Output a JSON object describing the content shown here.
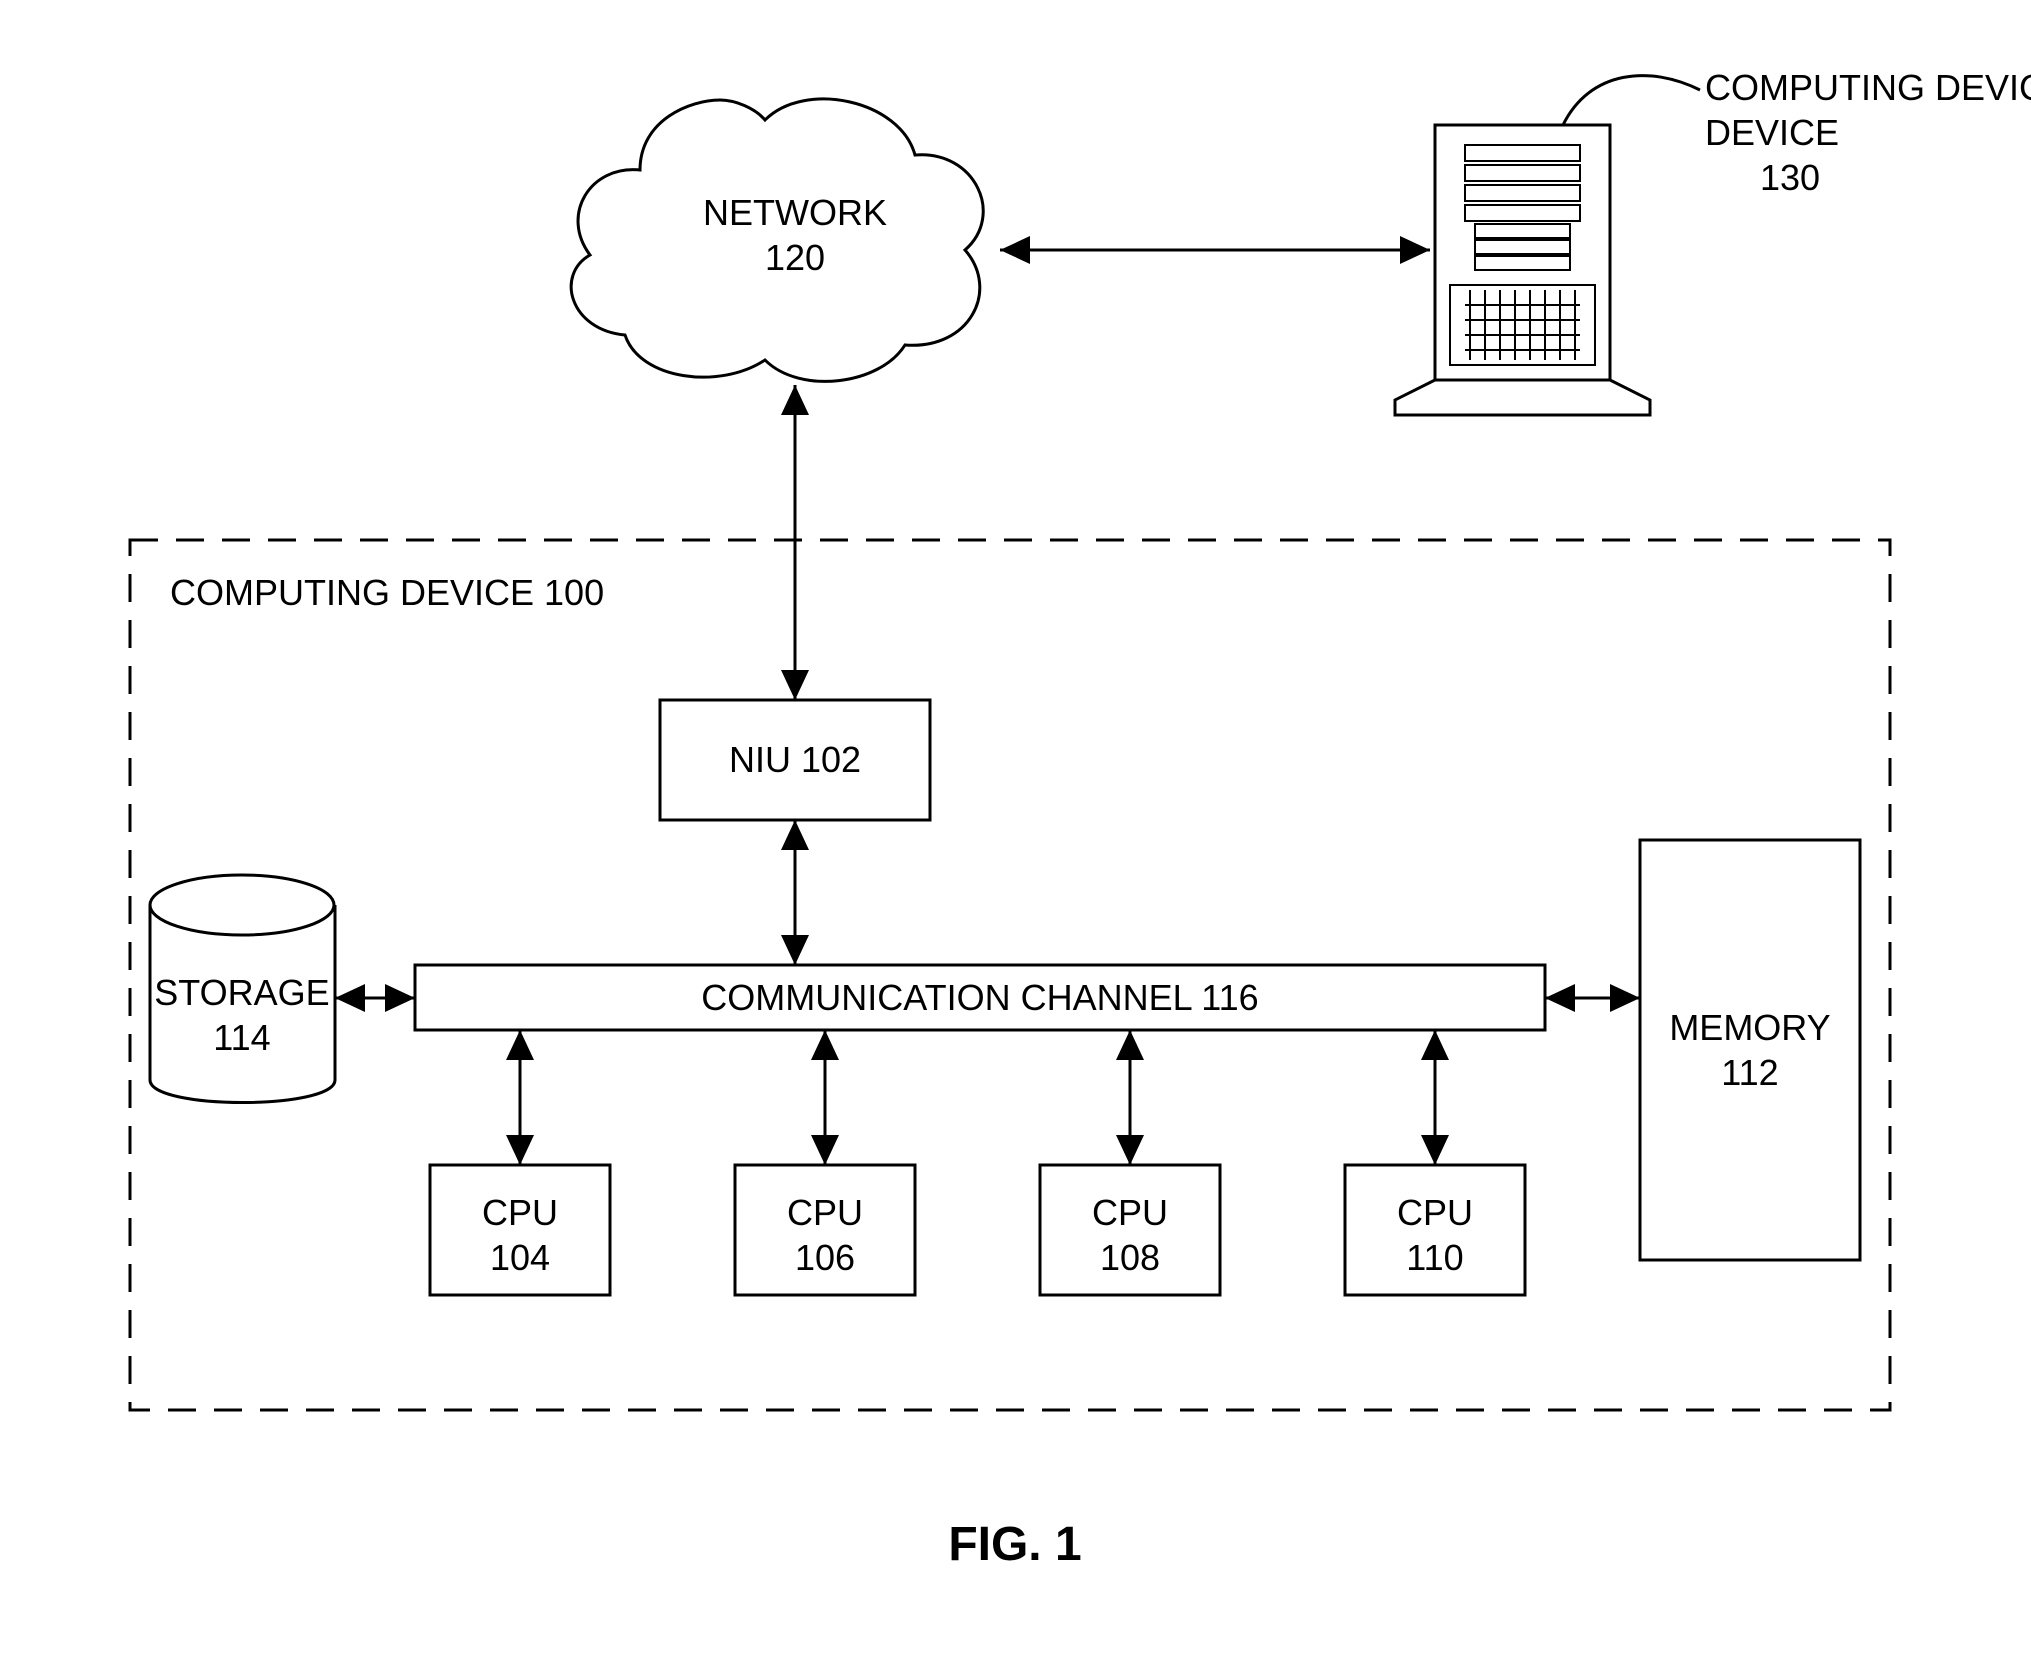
{
  "figure_caption": "FIG. 1",
  "computing_device_100_label": "COMPUTING DEVICE 100",
  "network": {
    "name": "NETWORK",
    "ref": "120"
  },
  "computing_device_ext": {
    "name": "COMPUTING DEVICE",
    "ref": "130"
  },
  "niu": {
    "label": "NIU 102"
  },
  "comm_channel": {
    "label": "COMMUNICATION CHANNEL 116"
  },
  "storage": {
    "name": "STORAGE",
    "ref": "114"
  },
  "memory": {
    "name": "MEMORY",
    "ref": "112"
  },
  "cpu_104": {
    "name": "CPU",
    "ref": "104"
  },
  "cpu_106": {
    "name": "CPU",
    "ref": "106"
  },
  "cpu_108": {
    "name": "CPU",
    "ref": "108"
  },
  "cpu_110": {
    "name": "CPU",
    "ref": "110"
  }
}
